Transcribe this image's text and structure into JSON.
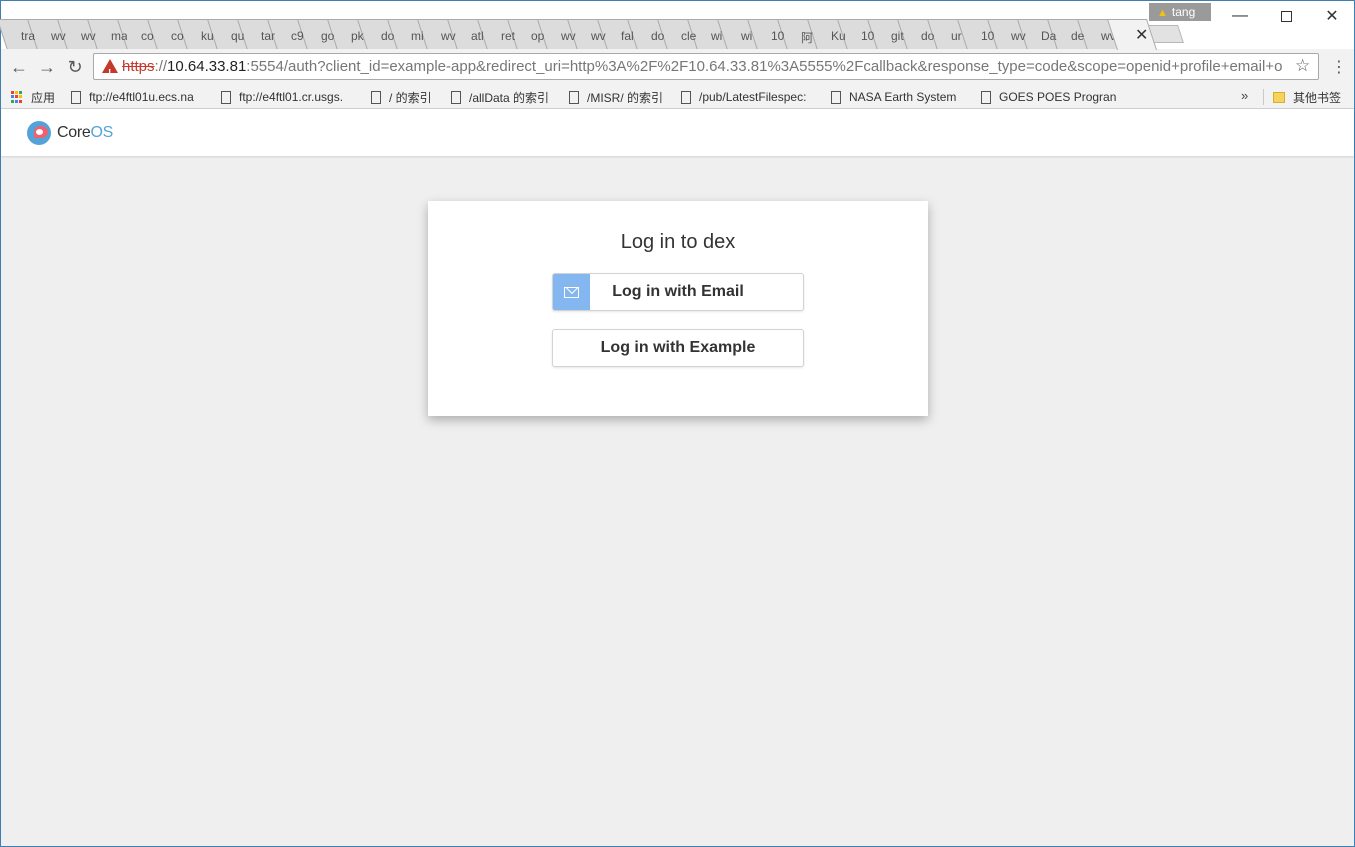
{
  "browser": {
    "tabs": [
      "tra",
      "wv",
      "wv",
      "ma",
      "co",
      "co",
      "ku",
      "qu",
      "tar",
      "c9",
      "go",
      "pk",
      "do",
      "mi",
      "wv",
      "atl",
      "ret",
      "op",
      "wv",
      "wv",
      "fal",
      "do",
      "cle",
      "wi",
      "wi",
      "10",
      "阿",
      "Ku",
      "10",
      "git",
      "do",
      "ur",
      "10",
      "wv",
      "Da",
      "de",
      "wv"
    ],
    "active_tab_close": "✕",
    "profile_name": "tang",
    "address": {
      "scheme": "https",
      "rest_before_host": "://",
      "host": "10.64.33.81",
      "path": ":5554/auth?client_id=example-app&redirect_uri=http%3A%2F%2F10.64.33.81%3A5555%2Fcallback&response_type=code&scope=openid+profile+email+o"
    },
    "bookmarks": {
      "apps_label": "应用",
      "items": [
        "ftp://e4ftl01u.ecs.na",
        "ftp://e4ftl01.cr.usgs.",
        "/ 的索引",
        "/allData 的索引",
        "/MISR/ 的索引",
        "/pub/LatestFilespec:",
        "NASA Earth System",
        "GOES POES Progran"
      ],
      "overflow": "»",
      "other_bookmarks": "其他书签"
    }
  },
  "page": {
    "logo": {
      "core": "Core",
      "os": "OS"
    },
    "title": "Log in to dex",
    "buttons": {
      "email": "Log in with Email",
      "example": "Log in with Example"
    }
  },
  "colors": {
    "accent": "#84b6ef",
    "logo_blue": "#53a3da",
    "logo_red": "#f1606d",
    "warning": "#c5392b",
    "page_bg": "#efefef"
  }
}
